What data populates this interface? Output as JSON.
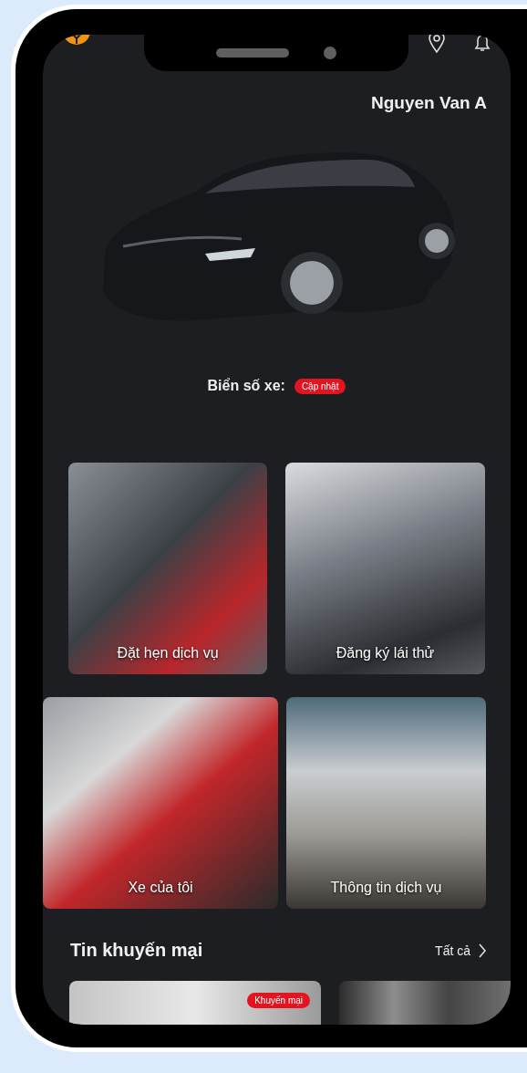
{
  "header": {
    "user_name": "Nguyen Van A"
  },
  "plate": {
    "label": "Biển số xe:",
    "badge": "Cập nhật"
  },
  "services": [
    {
      "label": "Đặt hẹn dịch vụ"
    },
    {
      "label": "Đăng ký lái thử"
    },
    {
      "label": "Xe của tôi"
    },
    {
      "label": "Thông tin dịch vụ"
    }
  ],
  "promotions": {
    "title": "Tin khuyến mại",
    "see_all": "Tất cả",
    "cards": [
      {
        "badge": "Khuyến mại"
      }
    ]
  }
}
